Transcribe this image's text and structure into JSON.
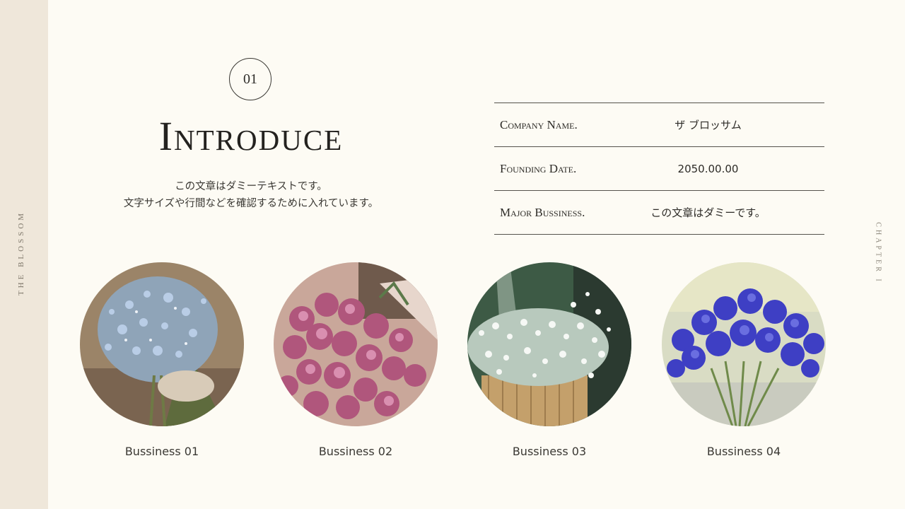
{
  "side": {
    "brand": "THE BLOSSOM",
    "chapter": "CHAPTER I"
  },
  "section": {
    "number": "01",
    "title": "Introduce",
    "description_lines": [
      "この文章はダミーテキストです。",
      "文字サイズや行間などを確認するために入れています。"
    ]
  },
  "info": [
    {
      "label": "Company Name.",
      "value": "ザ ブロッサム"
    },
    {
      "label": "Founding Date.",
      "value": "2050.00.00"
    },
    {
      "label": "Major Bussiness.",
      "value": "この文章はダミーです。"
    }
  ],
  "businesses": [
    {
      "caption": "Bussiness 01",
      "image": "blue-wildflower-bouquet"
    },
    {
      "caption": "Bussiness 02",
      "image": "pink-peony-bouquet"
    },
    {
      "caption": "Bussiness 03",
      "image": "white-babys-breath-basket"
    },
    {
      "caption": "Bussiness 04",
      "image": "blue-cornflower-bouquet"
    }
  ],
  "colors": {
    "background": "#fdfbf4",
    "side_strip": "#efe7da",
    "text": "#2d2b27"
  }
}
